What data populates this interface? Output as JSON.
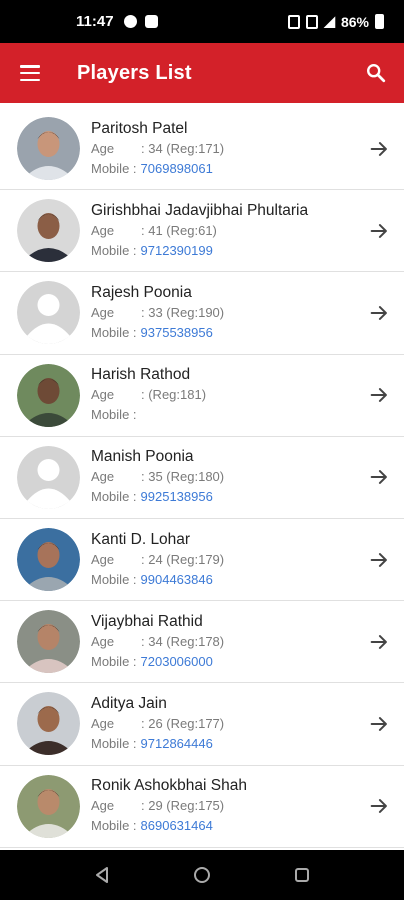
{
  "status_bar": {
    "time": "11:47",
    "battery": "86%"
  },
  "app_bar": {
    "title": "Players List"
  },
  "labels": {
    "age": "Age",
    "mobile": "Mobile :"
  },
  "players": [
    {
      "name": "Paritosh Patel",
      "age": ": 34 (Reg:171)",
      "mobile": "7069898061",
      "photo": "photo-1"
    },
    {
      "name": "Girishbhai Jadavjibhai Phultaria",
      "age": ": 41 (Reg:61)",
      "mobile": "9712390199",
      "photo": "photo-2"
    },
    {
      "name": "Rajesh Poonia",
      "age": ": 33 (Reg:190)",
      "mobile": "9375538956",
      "photo": "placeholder"
    },
    {
      "name": "Harish Rathod",
      "age": ": (Reg:181)",
      "mobile": "",
      "photo": "photo-4"
    },
    {
      "name": "Manish Poonia",
      "age": ": 35 (Reg:180)",
      "mobile": "9925138956",
      "photo": "placeholder"
    },
    {
      "name": "Kanti D. Lohar",
      "age": ": 24 (Reg:179)",
      "mobile": "9904463846",
      "photo": "photo-6"
    },
    {
      "name": "Vijaybhai Rathid",
      "age": ": 34 (Reg:178)",
      "mobile": "7203006000",
      "photo": "photo-7"
    },
    {
      "name": "Aditya Jain",
      "age": ": 26 (Reg:177)",
      "mobile": "9712864446",
      "photo": "photo-8"
    },
    {
      "name": "Ronik Ashokbhai Shah",
      "age": ": 29 (Reg:175)",
      "mobile": "8690631464",
      "photo": "photo-9"
    }
  ],
  "colors": {
    "accent": "#d32129",
    "link": "#3d7ad6"
  },
  "icons": {
    "menu": "hamburger-icon",
    "search": "search-icon",
    "row_action": "arrow-right-icon"
  }
}
